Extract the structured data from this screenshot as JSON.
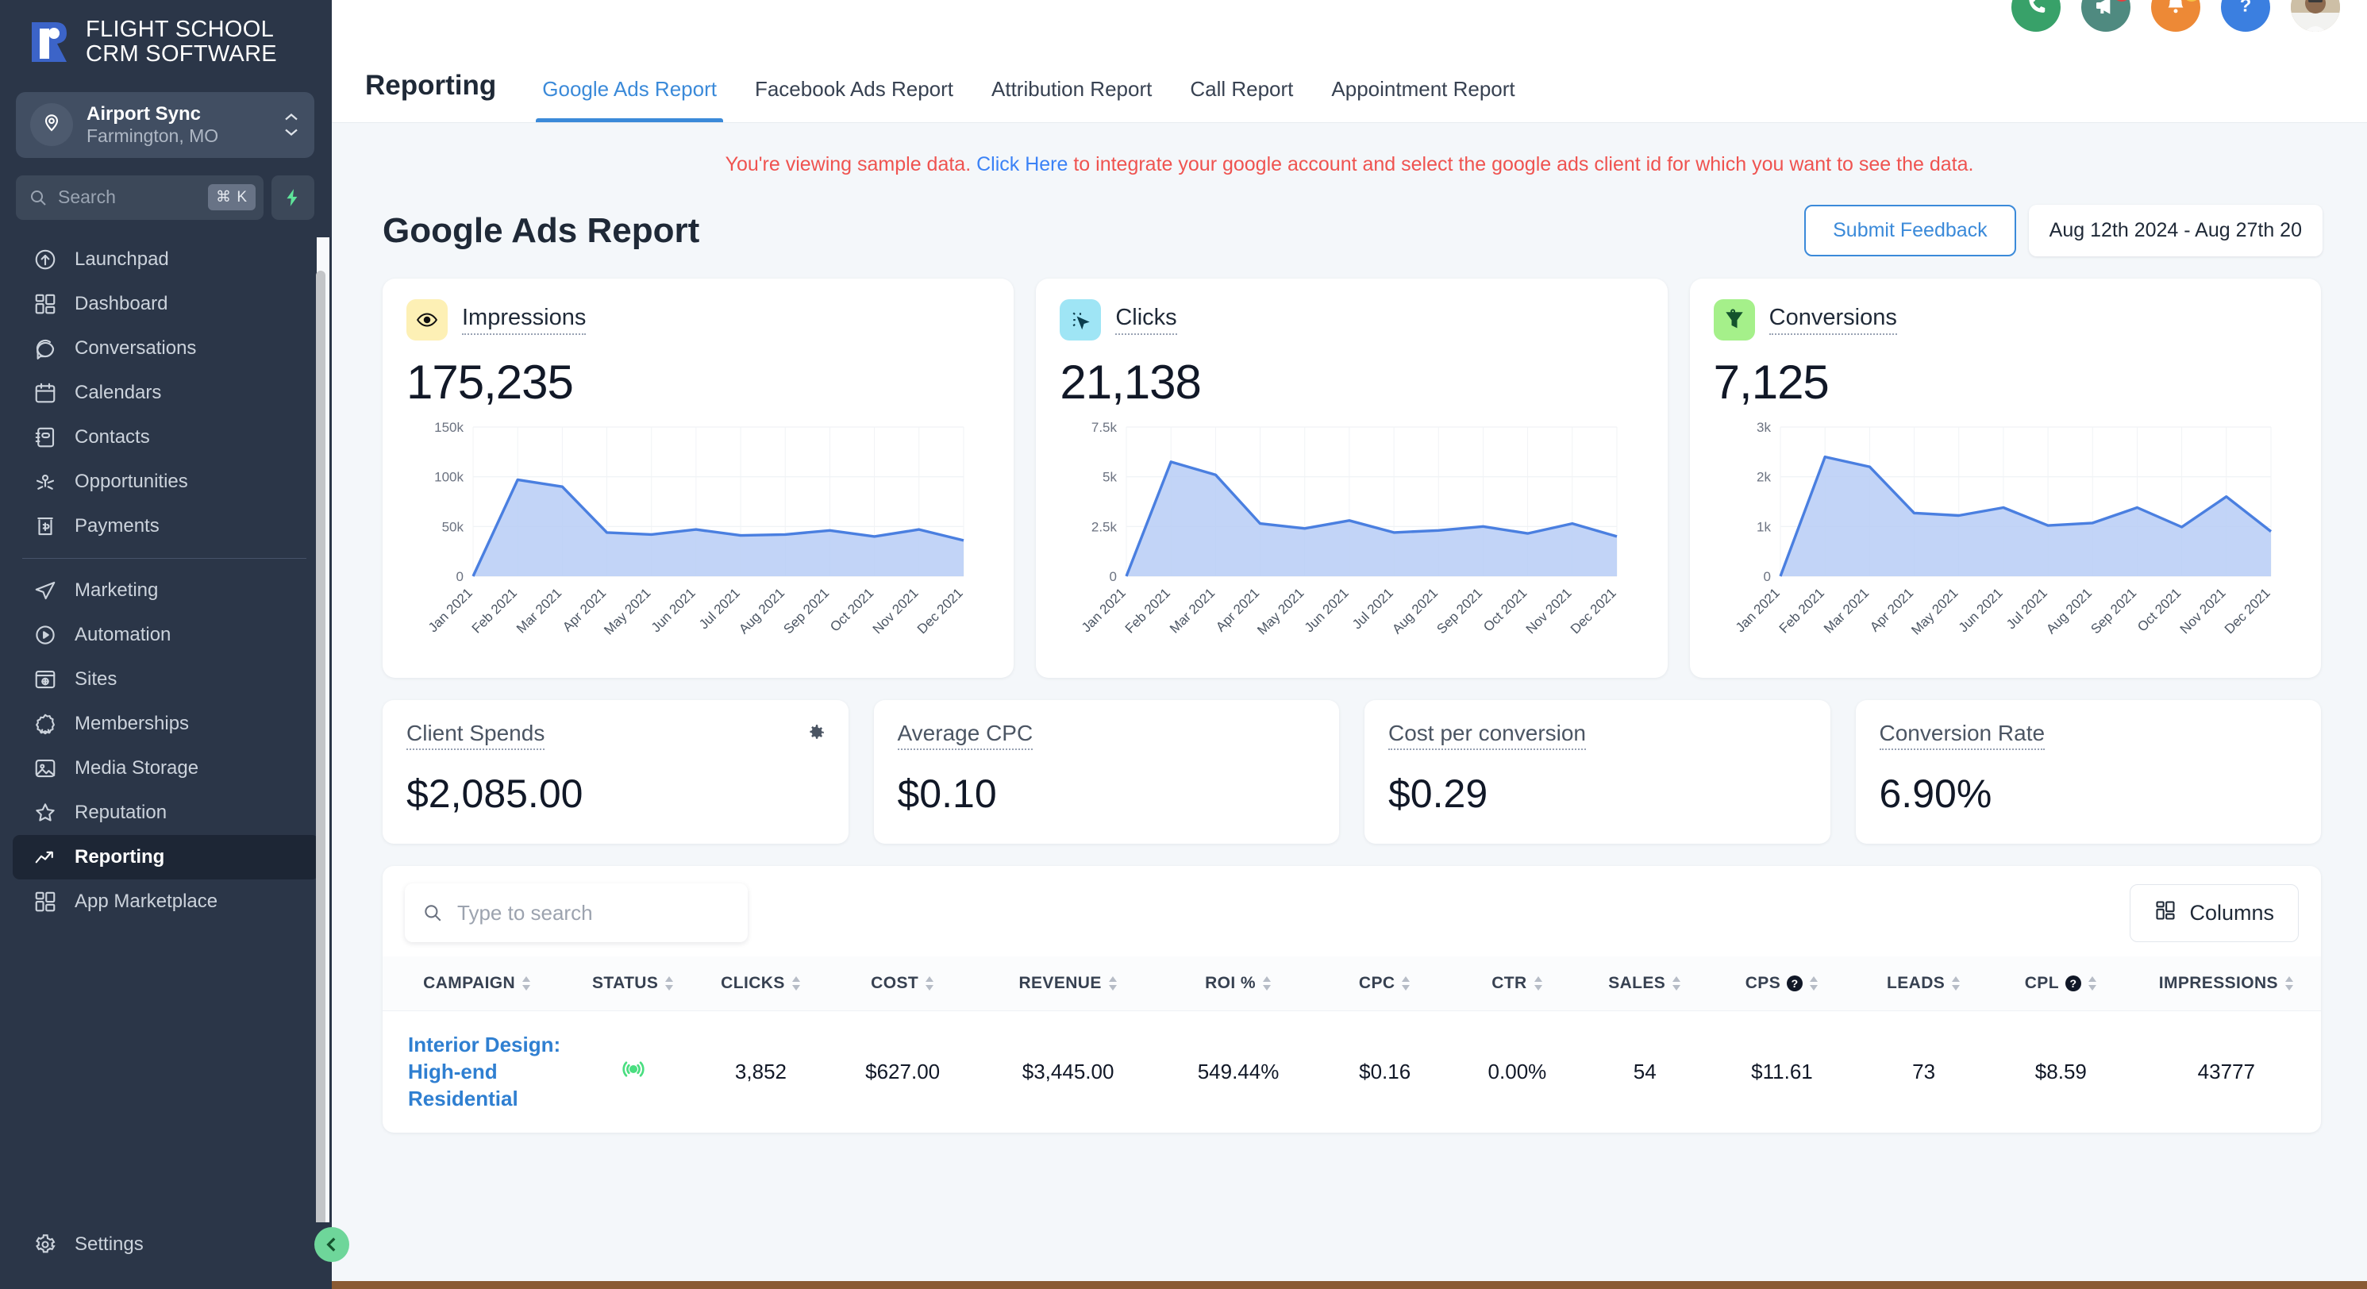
{
  "brand": {
    "line1": "FLIGHT SCHOOL",
    "line2": "CRM SOFTWARE",
    "accent": "#3c64c8"
  },
  "location": {
    "name": "Airport Sync",
    "sub": "Farmington, MO"
  },
  "search": {
    "placeholder": "Search",
    "shortcut": "⌘ K"
  },
  "sidebar": {
    "group1": [
      {
        "label": "Launchpad",
        "icon": "rocket-icon"
      },
      {
        "label": "Dashboard",
        "icon": "grid-icon"
      },
      {
        "label": "Conversations",
        "icon": "chat-icon"
      },
      {
        "label": "Calendars",
        "icon": "calendar-icon"
      },
      {
        "label": "Contacts",
        "icon": "contacts-icon"
      },
      {
        "label": "Opportunities",
        "icon": "opportunities-icon"
      },
      {
        "label": "Payments",
        "icon": "payments-icon"
      }
    ],
    "group2": [
      {
        "label": "Marketing",
        "icon": "send-icon"
      },
      {
        "label": "Automation",
        "icon": "play-circle-icon"
      },
      {
        "label": "Sites",
        "icon": "browser-icon"
      },
      {
        "label": "Memberships",
        "icon": "badge-icon"
      },
      {
        "label": "Media Storage",
        "icon": "image-icon"
      },
      {
        "label": "Reputation",
        "icon": "star-icon"
      },
      {
        "label": "Reporting",
        "icon": "trending-up-icon",
        "active": true
      },
      {
        "label": "App Marketplace",
        "icon": "grid-icon"
      }
    ],
    "settings": {
      "label": "Settings",
      "icon": "gear-icon"
    }
  },
  "header": {
    "section": "Reporting",
    "tabs": [
      {
        "label": "Google Ads Report",
        "active": true
      },
      {
        "label": "Facebook Ads Report",
        "active": false
      },
      {
        "label": "Attribution Report",
        "active": false
      },
      {
        "label": "Call Report",
        "active": false
      },
      {
        "label": "Appointment Report",
        "active": false
      }
    ],
    "icons": [
      {
        "name": "phone-icon",
        "color": "#38a169"
      },
      {
        "name": "megaphone-icon",
        "color": "#4f8a80",
        "badge": "#e53e3e"
      },
      {
        "name": "bell-icon",
        "color": "#ed8936",
        "badge": "#f6c244"
      },
      {
        "name": "help-icon",
        "color": "#3b7fe0"
      },
      {
        "name": "avatar",
        "color": "#c9b89a"
      }
    ]
  },
  "notice": {
    "before": "You're viewing sample data. ",
    "link": "Click Here",
    "after": " to integrate your google account and select the google ads client id for which you want to see the data."
  },
  "page": {
    "title": "Google Ads Report",
    "feedback_label": "Submit Feedback",
    "date_range": "Aug 12th 2024 - Aug 27th 20"
  },
  "kpi_cards": [
    {
      "label": "Impressions",
      "value": "175,235",
      "icon": "eye-icon",
      "icon_bg": "#fdf0b5"
    },
    {
      "label": "Clicks",
      "value": "21,138",
      "icon": "click-icon",
      "icon_bg": "#9fe5f5"
    },
    {
      "label": "Conversions",
      "value": "7,125",
      "icon": "funnel-icon",
      "icon_bg": "#a5f08a"
    }
  ],
  "metric_cards": [
    {
      "label": "Client Spends",
      "value": "$2,085.00",
      "gear": true
    },
    {
      "label": "Average CPC",
      "value": "$0.10",
      "gear": false
    },
    {
      "label": "Cost per conversion",
      "value": "$0.29",
      "gear": false
    },
    {
      "label": "Conversion Rate",
      "value": "6.90%",
      "gear": false
    }
  ],
  "table": {
    "search_placeholder": "Type to search",
    "columns_label": "Columns",
    "columns": [
      {
        "label": "CAMPAIGN",
        "help": false
      },
      {
        "label": "STATUS",
        "help": false
      },
      {
        "label": "CLICKS",
        "help": false
      },
      {
        "label": "COST",
        "help": false
      },
      {
        "label": "REVENUE",
        "help": false
      },
      {
        "label": "ROI %",
        "help": false
      },
      {
        "label": "CPC",
        "help": false
      },
      {
        "label": "CTR",
        "help": false
      },
      {
        "label": "SALES",
        "help": false
      },
      {
        "label": "CPS",
        "help": true
      },
      {
        "label": "LEADS",
        "help": false
      },
      {
        "label": "CPL",
        "help": true
      },
      {
        "label": "IMPRESSIONS",
        "help": false
      }
    ],
    "rows": [
      {
        "campaign": "Interior Design: High-end Residential",
        "status": "live",
        "clicks": "3,852",
        "cost": "$627.00",
        "revenue": "$3,445.00",
        "roi": "549.44%",
        "cpc": "$0.16",
        "ctr": "0.00%",
        "sales": "54",
        "cps": "$11.61",
        "leads": "73",
        "cpl": "$8.59",
        "impressions": "43777"
      }
    ]
  },
  "chart_data": [
    {
      "type": "area",
      "title": "Impressions",
      "categories": [
        "Jan 2021",
        "Feb 2021",
        "Mar 2021",
        "Apr 2021",
        "May 2021",
        "Jun 2021",
        "Jul 2021",
        "Aug 2021",
        "Sep 2021",
        "Oct 2021",
        "Nov 2021",
        "Dec 2021"
      ],
      "values": [
        0,
        97000,
        90000,
        44000,
        42000,
        47000,
        41000,
        42000,
        46000,
        40000,
        47000,
        36000
      ],
      "ylim": [
        0,
        150000
      ],
      "yticks": [
        0,
        50000,
        100000,
        150000
      ],
      "ytick_labels": [
        "0",
        "50k",
        "100k",
        "150k"
      ],
      "xlabel": "",
      "ylabel": "",
      "grid": true,
      "legend": "none"
    },
    {
      "type": "area",
      "title": "Clicks",
      "categories": [
        "Jan 2021",
        "Feb 2021",
        "Mar 2021",
        "Apr 2021",
        "May 2021",
        "Jun 2021",
        "Jul 2021",
        "Aug 2021",
        "Sep 2021",
        "Oct 2021",
        "Nov 2021",
        "Dec 2021"
      ],
      "values": [
        0,
        5750,
        5100,
        2650,
        2400,
        2800,
        2200,
        2300,
        2500,
        2150,
        2650,
        2000
      ],
      "ylim": [
        0,
        7500
      ],
      "yticks": [
        0,
        2500,
        5000,
        7500
      ],
      "ytick_labels": [
        "0",
        "2.5k",
        "5k",
        "7.5k"
      ],
      "xlabel": "",
      "ylabel": "",
      "grid": true,
      "legend": "none"
    },
    {
      "type": "area",
      "title": "Conversions",
      "categories": [
        "Jan 2021",
        "Feb 2021",
        "Mar 2021",
        "Apr 2021",
        "May 2021",
        "Jun 2021",
        "Jul 2021",
        "Aug 2021",
        "Sep 2021",
        "Oct 2021",
        "Nov 2021",
        "Dec 2021"
      ],
      "values": [
        0,
        2400,
        2200,
        1270,
        1220,
        1380,
        1020,
        1070,
        1380,
        990,
        1600,
        900
      ],
      "ylim": [
        0,
        3000
      ],
      "yticks": [
        0,
        1000,
        2000,
        3000
      ],
      "ytick_labels": [
        "0",
        "1k",
        "2k",
        "3k"
      ],
      "xlabel": "",
      "ylabel": "",
      "grid": true,
      "legend": "none"
    }
  ]
}
